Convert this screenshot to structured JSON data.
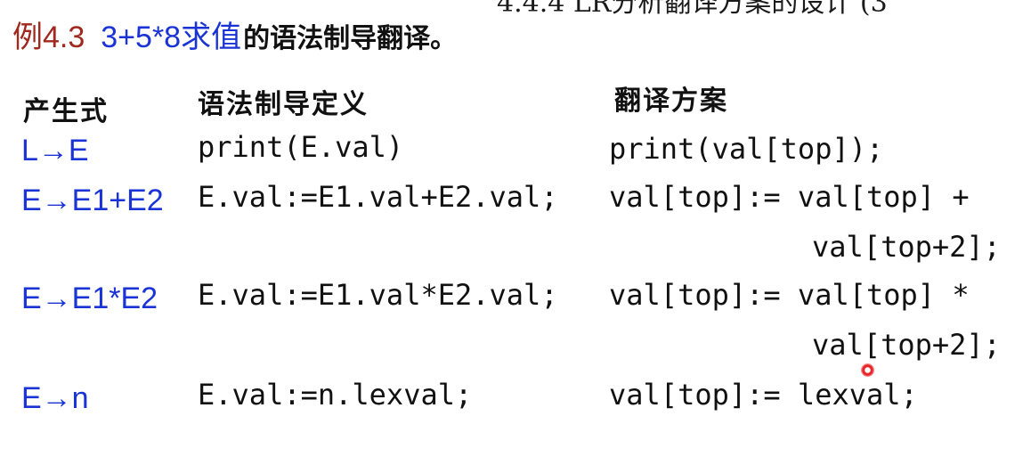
{
  "slide": {
    "top_cut_text": "4.4.4 LR分析翻译方案的设计 (3",
    "title": {
      "example": "例4.3",
      "expression": "3+5*8求值",
      "rest": "的语法制导翻译。"
    },
    "headers": {
      "production": "产生式",
      "definition": "语法制导定义",
      "scheme": "翻译方案"
    },
    "rows": [
      {
        "production": "L→E",
        "definition": "print(E.val)",
        "scheme": "print(val[top]);",
        "scheme_cont": ""
      },
      {
        "production": "E→E1+E2",
        "definition": "E.val:=E1.val+E2.val;",
        "scheme": "val[top]:= val[top] +",
        "scheme_cont": "val[top+2];"
      },
      {
        "production": "E→E1*E2",
        "definition": "E.val:=E1.val*E2.val;",
        "scheme": "val[top]:= val[top] *",
        "scheme_cont": "val[top+2];"
      },
      {
        "production": "E→n",
        "definition": "E.val:=n.lexval;",
        "scheme": "val[top]:= lexval;",
        "scheme_cont": ""
      }
    ]
  }
}
